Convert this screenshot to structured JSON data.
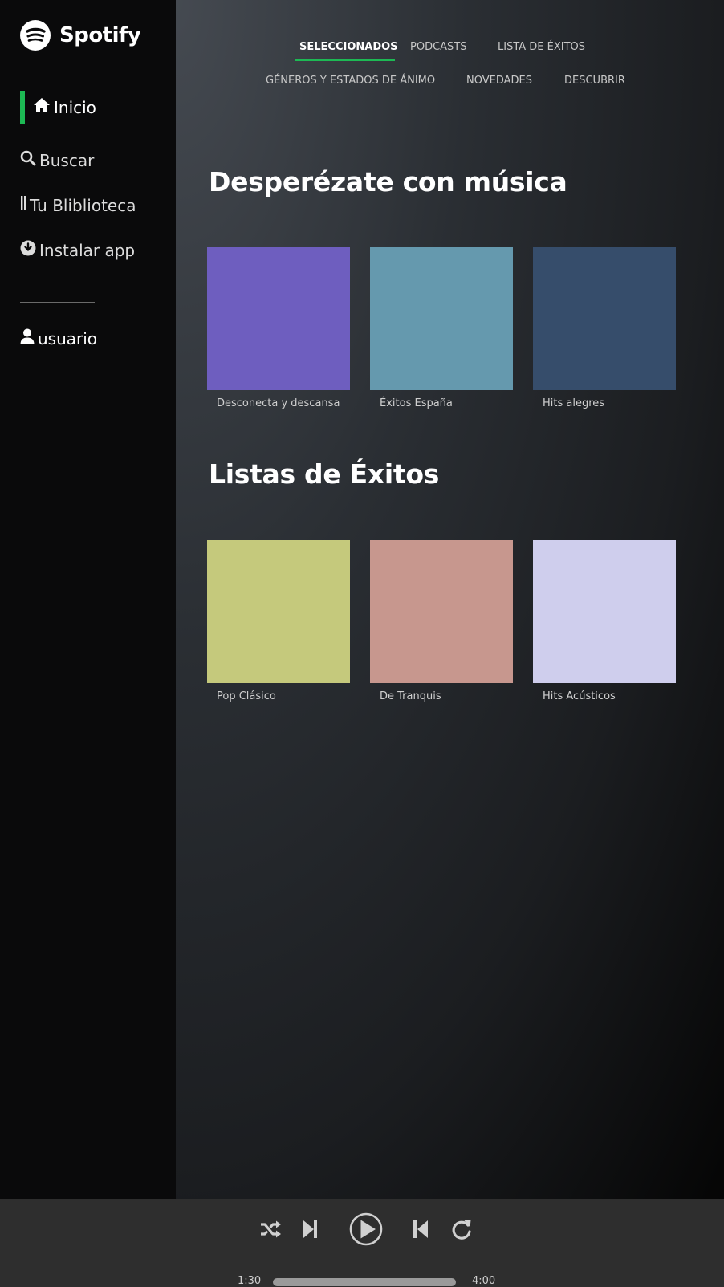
{
  "app": {
    "name": "Spotify"
  },
  "sidebar": {
    "items": [
      {
        "label": "Inicio",
        "icon": "home-icon",
        "active": true
      },
      {
        "label": "Buscar",
        "icon": "search-icon"
      },
      {
        "label": "Tu Bliblioteca",
        "icon": "library-icon"
      },
      {
        "label": "Instalar app",
        "icon": "download-icon"
      }
    ],
    "user": {
      "label": "usuario",
      "icon": "user-icon"
    },
    "accent": "#1db954"
  },
  "tabs": {
    "row1": [
      "SELECCIONADOS",
      "PODCASTS",
      "LISTA DE ÉXITOS"
    ],
    "row2": [
      "GÉNEROS Y ESTADOS DE ÁNIMO",
      "NOVEDADES",
      "DESCUBRIR"
    ],
    "active": "SELECCIONADOS"
  },
  "sections": [
    {
      "title": "Desperézate con música",
      "cards": [
        {
          "label": "Desconecta y descansa",
          "color": "#6e5ebf"
        },
        {
          "label": "Éxitos España",
          "color": "#6599ae"
        },
        {
          "label": "Hits alegres",
          "color": "#364d6b"
        }
      ]
    },
    {
      "title": "Listas de Éxitos",
      "cards": [
        {
          "label": "Pop Clásico",
          "color": "#c5c97c"
        },
        {
          "label": "De Tranquis",
          "color": "#c7978e"
        },
        {
          "label": "Hits Acústicos",
          "color": "#cfceed"
        }
      ]
    }
  ],
  "player": {
    "controls": [
      "shuffle-icon",
      "skip-forward-icon",
      "play-icon",
      "skip-back-icon",
      "repeat-icon"
    ],
    "current_time": "1:30",
    "total_time": "4:00"
  }
}
